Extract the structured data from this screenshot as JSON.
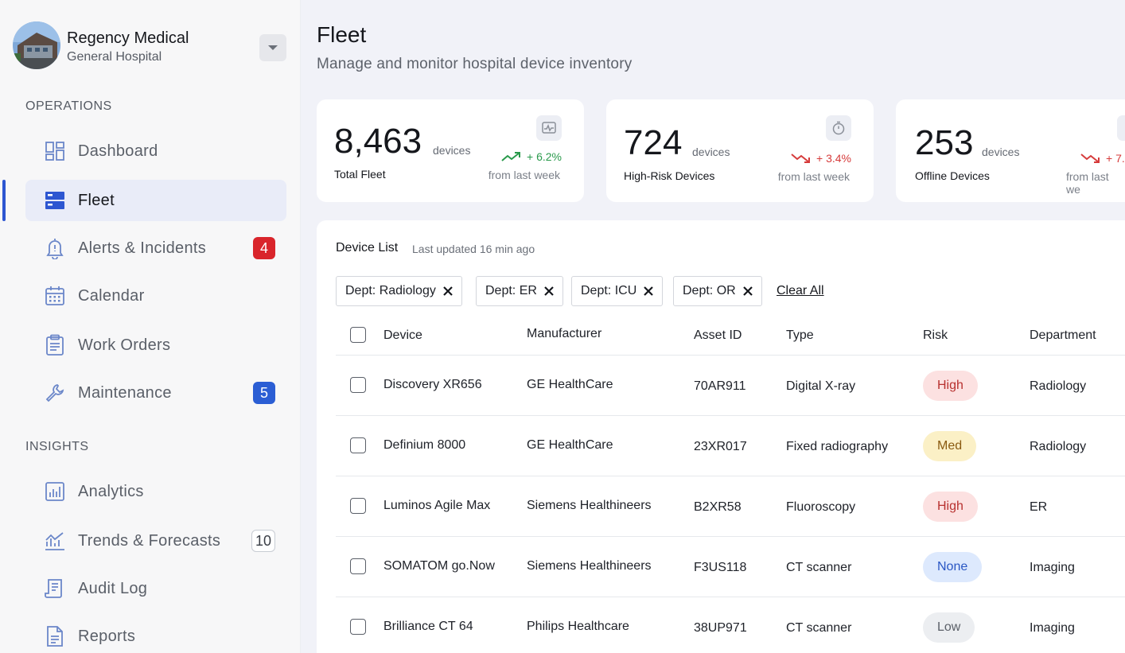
{
  "org": {
    "name": "Regency Medical",
    "subtitle": "General Hospital"
  },
  "sidebar": {
    "sections": [
      {
        "label": "OPERATIONS",
        "items": [
          {
            "label": "Dashboard",
            "icon": "dashboard-icon"
          },
          {
            "label": "Fleet",
            "icon": "fleet-icon",
            "active": true
          },
          {
            "label": "Alerts & Incidents",
            "icon": "alert-bell-icon",
            "badge": "4"
          },
          {
            "label": "Calendar",
            "icon": "calendar-icon"
          },
          {
            "label": "Work Orders",
            "icon": "clipboard-icon"
          },
          {
            "label": "Maintenance",
            "icon": "wrench-icon",
            "badge": "5"
          }
        ]
      },
      {
        "label": "INSIGHTS",
        "items": [
          {
            "label": "Analytics",
            "icon": "bar-chart-icon"
          },
          {
            "label": "Trends & Forecasts",
            "icon": "trend-chart-icon",
            "badge": "10"
          },
          {
            "label": "Audit Log",
            "icon": "receipt-icon"
          },
          {
            "label": "Reports",
            "icon": "document-icon"
          }
        ]
      }
    ]
  },
  "page": {
    "title": "Fleet",
    "subtitle": "Manage and monitor hospital device inventory"
  },
  "stats": [
    {
      "value": "8,463",
      "unit": "devices",
      "label": "Total Fleet",
      "trend": "+ 6.2%",
      "direction": "up",
      "from": "from last week",
      "icon": "activity-monitor-icon"
    },
    {
      "value": "724",
      "unit": "devices",
      "label": "High-Risk Devices",
      "trend": "+ 3.4%",
      "direction": "down",
      "from": "from last week",
      "icon": "timer-icon"
    },
    {
      "value": "253",
      "unit": "devices",
      "label": "Offline Devices",
      "trend": "+ 7.",
      "direction": "down",
      "from": "from last we",
      "icon": "offline-icon"
    }
  ],
  "device_list": {
    "title": "Device List",
    "updated": "Last updated 16 min ago",
    "filters": [
      "Dept: Radiology",
      "Dept: ER",
      "Dept: ICU",
      "Dept: OR"
    ],
    "clear_all": "Clear All",
    "columns": [
      "Device",
      "Manufacturer",
      "Asset ID",
      "Type",
      "Risk",
      "Department"
    ],
    "rows": [
      {
        "device": "Discovery XR656",
        "manufacturer": "GE HealthCare",
        "asset": "70AR911",
        "type": "Digital X-ray",
        "risk": "High",
        "dept": "Radiology"
      },
      {
        "device": "Definium 8000",
        "manufacturer": "GE HealthCare",
        "asset": "23XR017",
        "type": "Fixed radiography",
        "risk": "Med",
        "dept": "Radiology"
      },
      {
        "device": "Luminos Agile Max",
        "manufacturer": "Siemens Healthineers",
        "asset": "B2XR58",
        "type": "Fluoroscopy",
        "risk": "High",
        "dept": "ER"
      },
      {
        "device": "SOMATOM go.Now",
        "manufacturer": "Siemens Healthineers",
        "asset": "F3US118",
        "type": "CT scanner",
        "risk": "None",
        "dept": "Imaging"
      },
      {
        "device": "Brilliance CT 64",
        "manufacturer": "Philips Healthcare",
        "asset": "38UP971",
        "type": "CT scanner",
        "risk": "Low",
        "dept": "Imaging"
      }
    ]
  },
  "colors": {
    "accent": "#2d56d1",
    "danger": "#d9252b",
    "success": "#2a9a4c"
  }
}
